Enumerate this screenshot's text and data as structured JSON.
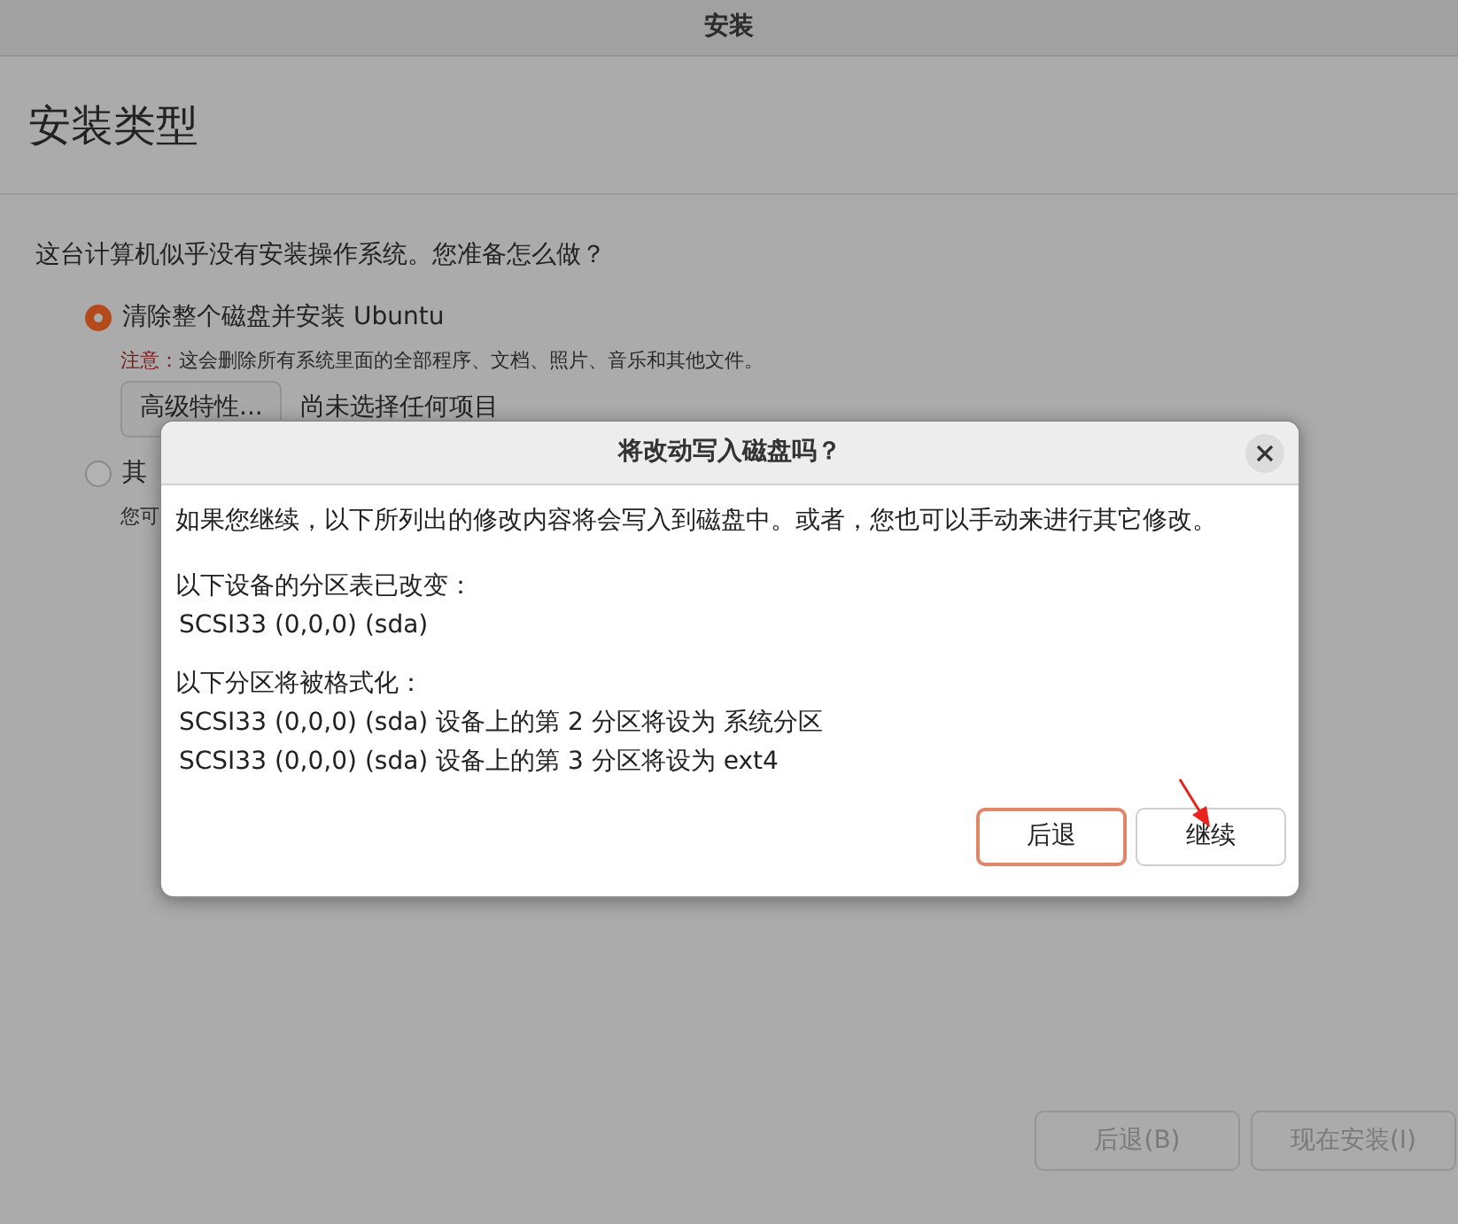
{
  "window": {
    "title": "安装"
  },
  "page": {
    "heading": "安装类型",
    "question": "这台计算机似乎没有安装操作系统。您准备怎么做？",
    "options": [
      {
        "label": "清除整个磁盘并安装 Ubuntu",
        "selected": true,
        "warning_label": "注意：",
        "warning": "这会删除所有系统里面的全部程序、文档、照片、音乐和其他文件。",
        "advanced_button": "高级特性...",
        "advanced_status": "尚未选择任何项目"
      },
      {
        "label": "其",
        "selected": false,
        "note": "您可"
      }
    ]
  },
  "buttons": [
    {
      "label": "后退(B)",
      "disabled": true
    },
    {
      "label": "现在安装(I)",
      "disabled": true
    }
  ],
  "dialog": {
    "title": "将改动写入磁盘吗？",
    "message": "如果您继续，以下所列出的修改内容将会写入到磁盘中。或者，您也可以手动来进行其它修改。",
    "sections": [
      {
        "heading": "以下设备的分区表已改变：",
        "lines": [
          "SCSI33 (0,0,0) (sda)"
        ]
      },
      {
        "heading": "以下分区将被格式化：",
        "lines": [
          "SCSI33 (0,0,0) (sda) 设备上的第 2 分区将设为 系统分区",
          "SCSI33 (0,0,0) (sda) 设备上的第 3 分区将设为 ext4"
        ]
      }
    ],
    "buttons": [
      {
        "label": "后退",
        "focused": true
      },
      {
        "label": "继续",
        "focused": false
      }
    ]
  }
}
